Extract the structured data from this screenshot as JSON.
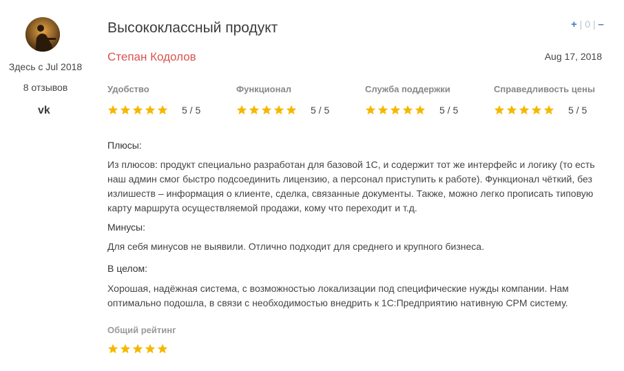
{
  "reviewer": {
    "since": "Здесь с Jul 2018",
    "reviews_count": "8 отзывов",
    "social_icon": "vk-icon",
    "avatar_icon": "avatar"
  },
  "review": {
    "title": "Высококлассный продукт",
    "author": "Степан Кодолов",
    "date": "Aug 17, 2018",
    "votes": {
      "plus": "+",
      "count": "0",
      "minus": "–",
      "separator": "|"
    },
    "categories": [
      {
        "label": "Удобство",
        "rating": 5,
        "score": "5 / 5"
      },
      {
        "label": "Функционал",
        "rating": 5,
        "score": "5 / 5"
      },
      {
        "label": "Служба поддержки",
        "rating": 5,
        "score": "5 / 5"
      },
      {
        "label": "Справедливость цены",
        "rating": 5,
        "score": "5 / 5"
      }
    ],
    "pros_label": "Плюсы:",
    "pros_text": "Из плюсов: продукт специально разработан для базовой 1С, и содержит тот же интерфейс и логику (то есть наш админ смог быстро подсоединить лицензию, а персонал приступить к работе). Функционал чёткий, без излишеств – информация о клиенте, сделка, связанные документы. Также, можно легко прописать типовую карту маршрута осуществляемой продажи, кому что переходит и т.д.",
    "cons_label": "Минусы:",
    "cons_text": "Для себя минусов не выявили. Отлично подходит для среднего и крупного бизнеса.",
    "overall_label_section": "В целом:",
    "overall_text": "Хорошая, надёжная система, с возможностью локализации под специфические нужды компании. Нам оптимально подошла, в связи с необходимостью внедрить к 1С:Предприятию нативную CPM систему.",
    "overall_rating_label": "Общий рейтинг",
    "overall_rating": 5
  },
  "colors": {
    "star": "#f5b800",
    "author": "#d9534f",
    "vote": "#4a7bb7"
  }
}
